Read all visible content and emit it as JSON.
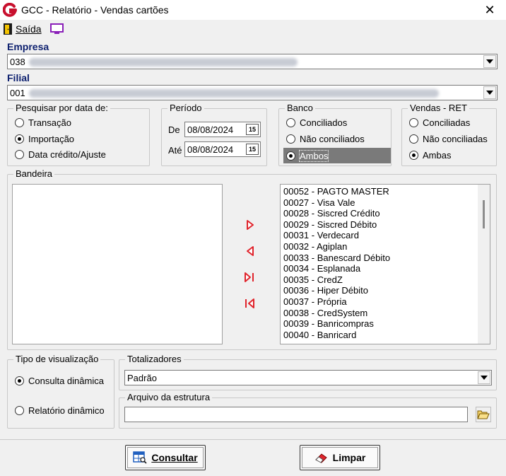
{
  "window": {
    "title": "GCC - Relatório - Vendas cartões",
    "close_glyph": "✕",
    "app_icon": "gcc-logo-icon"
  },
  "toolbar": {
    "exit_label": "Saída",
    "exit_icon": "exit-door-icon",
    "monitor_icon": "monitor-icon"
  },
  "empresa": {
    "label": "Empresa",
    "value": "038"
  },
  "filial": {
    "label": "Filial",
    "value": "001"
  },
  "search_by_date": {
    "legend": "Pesquisar por data de:",
    "options": [
      "Transação",
      "Importação",
      "Data crédito/Ajuste"
    ],
    "selected": 1
  },
  "periodo": {
    "legend": "Período",
    "from_label": "De",
    "from_value": "08/08/2024",
    "to_label": "Até",
    "to_value": "08/08/2024",
    "cal_glyph": "15"
  },
  "banco": {
    "legend": "Banco",
    "options": [
      "Conciliados",
      "Não conciliados",
      "Ambos"
    ],
    "selected": 2
  },
  "vendas_ret": {
    "legend": "Vendas - RET",
    "options": [
      "Conciliadas",
      "Não conciliadas",
      "Ambas"
    ],
    "selected": 2
  },
  "bandeira": {
    "legend": "Bandeira",
    "available": [
      "00052 - PAGTO MASTER",
      "00027 - Visa Vale",
      "00028 - Siscred Crédito",
      "00029 - Siscred Débito",
      "00031 - Verdecard",
      "00032 - Agiplan",
      "00033 - Banescard Débito",
      "00034 - Esplanada",
      "00035 - CredZ",
      "00036 - Hiper Débito",
      "00037 - Própria",
      "00038 - CredSystem",
      "00039 - Banricompras",
      "00040 - Banricard"
    ]
  },
  "tipo_visualizacao": {
    "legend": "Tipo de visualização",
    "options": [
      "Consulta dinâmica",
      "Relatório dinâmico"
    ],
    "selected": 0
  },
  "totalizadores": {
    "legend": "Totalizadores",
    "value": "Padrão"
  },
  "arquivo_estrutura": {
    "legend": "Arquivo da estrutura",
    "value": ""
  },
  "buttons": {
    "consultar": "Consultar",
    "limpar": "Limpar"
  },
  "colors": {
    "label_blue": "#0c1f6e",
    "arrow_red": "#e0242c",
    "logo_red": "#c8102e",
    "monitor_purple": "#8a1fb8"
  }
}
